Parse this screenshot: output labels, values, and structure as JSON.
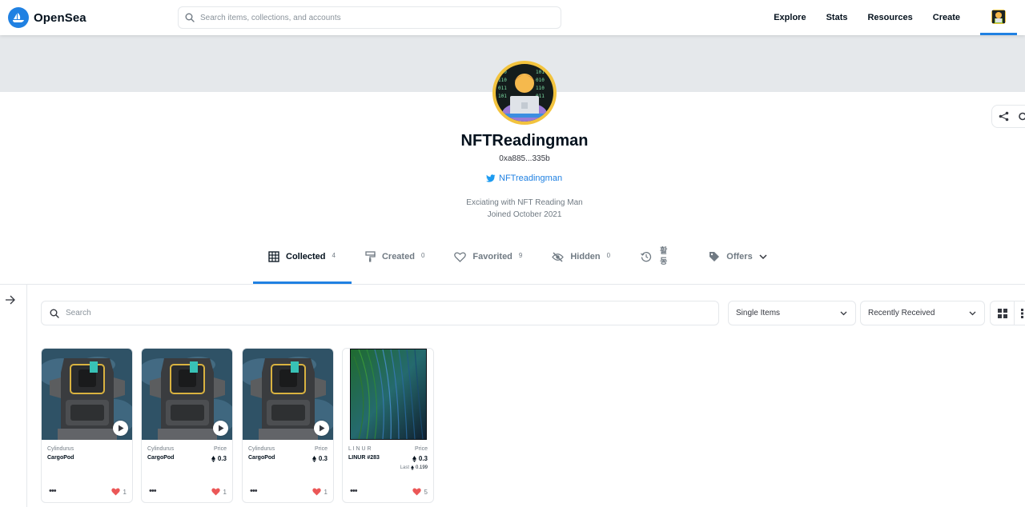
{
  "brand": {
    "name": "OpenSea",
    "accent": "#2081e2"
  },
  "search": {
    "placeholder": "Search items, collections, and accounts"
  },
  "nav": {
    "links": [
      "Explore",
      "Stats",
      "Resources",
      "Create"
    ]
  },
  "profile": {
    "name": "NFTReadingman",
    "address": "0xa885...335b",
    "twitter": "NFTreadingman",
    "bio": "Exciating with NFT Reading Man",
    "joined": "Joined October 2021"
  },
  "tabs": [
    {
      "label": "Collected",
      "count": "4",
      "icon": "grid-icon"
    },
    {
      "label": "Created",
      "count": "0",
      "icon": "brush-icon"
    },
    {
      "label": "Favorited",
      "count": "9",
      "icon": "heart-icon"
    },
    {
      "label": "Hidden",
      "count": "0",
      "icon": "eye-off-icon"
    },
    {
      "label_top": "활",
      "label_bottom": "동",
      "icon": "history-icon"
    },
    {
      "label": "Offers",
      "icon": "tag-icon"
    }
  ],
  "filters": {
    "search_placeholder": "Search",
    "items_select": "Single Items",
    "sort_select": "Recently Received"
  },
  "items": [
    {
      "collection": "Cylindurus",
      "name": "CargoPod",
      "likes": "1"
    },
    {
      "collection": "Cylindurus",
      "name": "CargoPod",
      "price_label": "Price",
      "price": "0.3",
      "likes": "1"
    },
    {
      "collection": "Cylindurus",
      "name": "CargoPod",
      "price_label": "Price",
      "price": "0.3",
      "likes": "1"
    },
    {
      "collection": "L I N U R",
      "name": "LINUR #283",
      "price_label": "Price",
      "price": "0.3",
      "last_label": "Last",
      "last_price": "0.199",
      "likes": "5"
    }
  ]
}
